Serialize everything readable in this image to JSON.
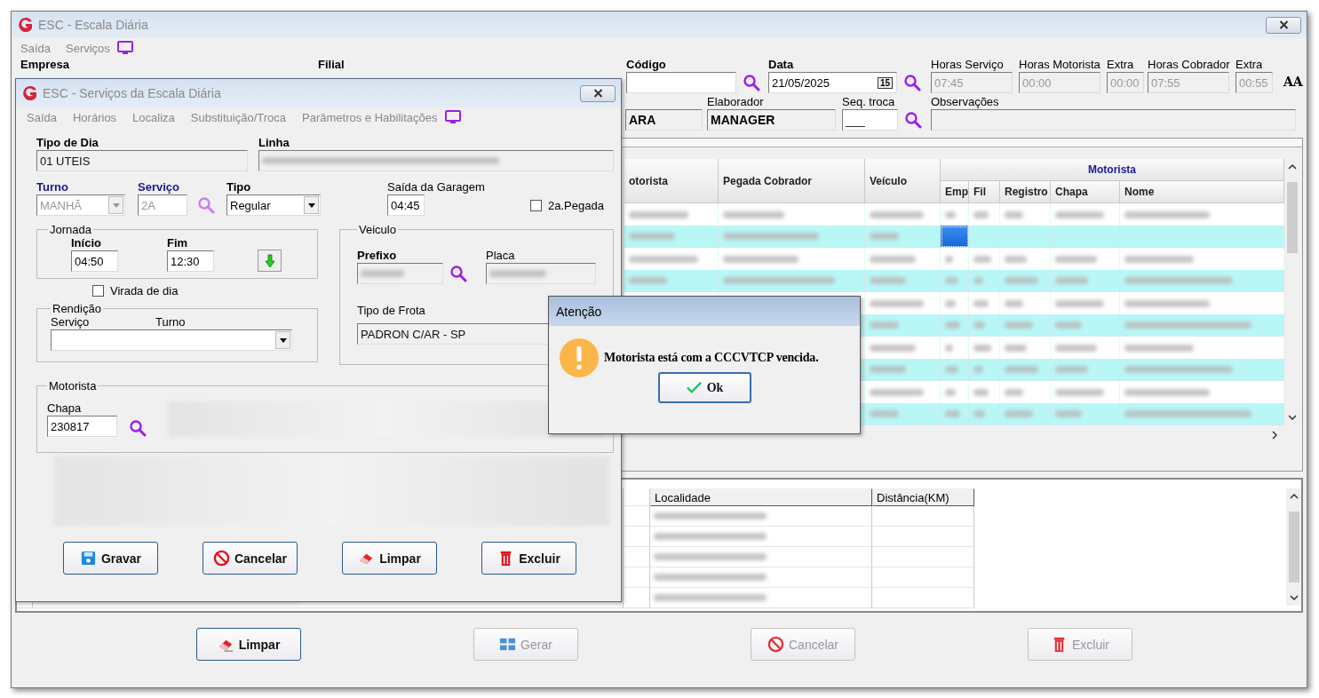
{
  "window": {
    "title": "ESC - Escala Diária"
  },
  "menu": [
    {
      "label": "Saída"
    },
    {
      "label": "Serviços"
    }
  ],
  "header": {
    "empresa_label": "Empresa",
    "filial_label": "Filial",
    "codigo": {
      "label": "Código"
    },
    "data": {
      "label": "Data",
      "value": "21/05/2025",
      "calendar": "15"
    },
    "horas": [
      {
        "label": "Horas Serviço",
        "value": "07:45",
        "kind": "wide"
      },
      {
        "label": "Horas Motorista",
        "value": "00:00",
        "kind": "wide"
      },
      {
        "label": "Extra",
        "value": "00:00",
        "kind": "narrow"
      },
      {
        "label": "Horas Cobrador",
        "value": "07:55",
        "kind": "wide"
      },
      {
        "label": "Extra",
        "value": "00:55",
        "kind": "narrow"
      }
    ],
    "font_button": "AA",
    "field_3": {
      "value": "ARA"
    },
    "elaborador": {
      "label": "Elaborador",
      "value": "MANAGER"
    },
    "seq_troca": {
      "label": "Seq. troca",
      "value": "___"
    },
    "observacoes": {
      "label": "Observações"
    }
  },
  "grid": {
    "group_header": "Motorista",
    "columns": [
      "otorista",
      "Pegada Cobrador",
      "Veículo"
    ],
    "sub_columns": [
      "Emp",
      "Fil",
      "Registro",
      "Chapa",
      "Nome"
    ],
    "rows": [
      {
        "selected": false
      },
      {
        "selected": true
      },
      {
        "selected": false
      },
      {
        "selected": false
      },
      {
        "selected": false
      },
      {
        "selected": false
      },
      {
        "selected": false
      },
      {
        "selected": false
      },
      {
        "selected": false
      },
      {
        "selected": false
      }
    ]
  },
  "lower_grid": {
    "columns": [
      "Localidade",
      "Distância(KM)"
    ]
  },
  "buttons": [
    {
      "label": "Limpar",
      "kind": "eraser",
      "disabled": false
    },
    {
      "label": "Gerar",
      "kind": "grid",
      "disabled": true
    },
    {
      "label": "Cancelar",
      "kind": "cancel",
      "disabled": true
    },
    {
      "label": "Excluir",
      "kind": "trash",
      "disabled": true
    }
  ],
  "dialog": {
    "title": "ESC - Serviços da Escala Diária",
    "menu": [
      {
        "label": "Saída"
      },
      {
        "label": "Horários"
      },
      {
        "label": "Localiza"
      },
      {
        "label": "Substituição/Troca"
      },
      {
        "label": "Parâmetros e Habilitações"
      }
    ],
    "tipo_de_dia": {
      "label": "Tipo de Dia",
      "value": "01 UTEIS"
    },
    "linha": {
      "label": "Linha"
    },
    "turno": {
      "label": "Turno",
      "value": "MANHÃ",
      "disabled": true
    },
    "servico": {
      "label": "Serviço",
      "value": "2A",
      "disabled": true
    },
    "tipo": {
      "label": "Tipo",
      "value": "Regular"
    },
    "saida_garagem": {
      "label": "Saída da Garagem",
      "value": "04:45"
    },
    "segunda_pegada": {
      "label": "2a.Pegada",
      "checked": false
    },
    "jornada": {
      "title": "Jornada",
      "inicio": {
        "label": "Início",
        "value": "04:50"
      },
      "fim": {
        "label": "Fim",
        "value": "12:30"
      }
    },
    "virada": {
      "label": "Virada de dia",
      "checked": false
    },
    "rendicao": {
      "title": "Rendição",
      "servico_label": "Serviço",
      "turno_label": "Turno"
    },
    "veiculo": {
      "title": "Veiculo",
      "prefixo_label": "Prefixo",
      "placa_label": "Placa",
      "tipo_frota": {
        "label": "Tipo de Frota",
        "value": "PADRON C/AR - SP"
      }
    },
    "motorista": {
      "title": "Motorista",
      "chapa": {
        "label": "Chapa",
        "value": "230817"
      }
    },
    "buttons": [
      {
        "label": "Gravar",
        "kind": "save",
        "disabled": false
      },
      {
        "label": "Cancelar",
        "kind": "cancel",
        "disabled": false
      },
      {
        "label": "Limpar",
        "kind": "eraser",
        "disabled": false
      },
      {
        "label": "Excluir",
        "kind": "trash",
        "disabled": false
      }
    ]
  },
  "alert": {
    "title": "Atenção",
    "message": "Motorista está com a CCCVTCP vencida.",
    "button": "Ok"
  }
}
